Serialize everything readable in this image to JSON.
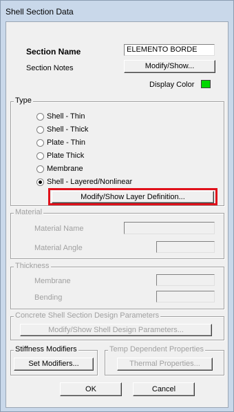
{
  "window": {
    "title": "Shell Section Data"
  },
  "section": {
    "name_label": "Section Name",
    "name_value": "ELEMENTO BORDE",
    "notes_label": "Section Notes",
    "notes_button": "Modify/Show...",
    "display_color_label": "Display Color",
    "display_color": "#00d800"
  },
  "type": {
    "legend": "Type",
    "options": [
      "Shell - Thin",
      "Shell - Thick",
      "Plate - Thin",
      "Plate Thick",
      "Membrane",
      "Shell - Layered/Nonlinear"
    ],
    "selected": "Shell - Layered/Nonlinear",
    "layer_button": "Modify/Show Layer Definition...",
    "highlight_color": "#e0101a"
  },
  "material": {
    "legend": "Material",
    "name_label": "Material Name",
    "angle_label": "Material Angle"
  },
  "thickness": {
    "legend": "Thickness",
    "membrane_label": "Membrane",
    "bending_label": "Bending"
  },
  "design": {
    "legend": "Concrete Shell Section Design Parameters",
    "button": "Modify/Show Shell Design Parameters..."
  },
  "stiffness": {
    "legend": "Stiffness Modifiers",
    "button": "Set Modifiers..."
  },
  "temp": {
    "legend": "Temp Dependent Properties",
    "button": "Thermal Properties..."
  },
  "footer": {
    "ok": "OK",
    "cancel": "Cancel"
  }
}
